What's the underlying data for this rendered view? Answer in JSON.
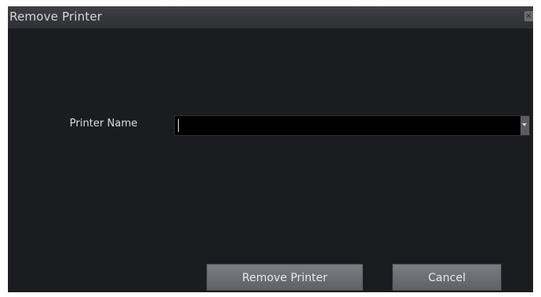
{
  "window": {
    "title": "Remove Printer",
    "close_label": "×"
  },
  "form": {
    "printer_name_label": "Printer Name",
    "printer_name_value": ""
  },
  "buttons": {
    "remove_label": "Remove Printer",
    "cancel_label": "Cancel"
  },
  "colors": {
    "dialog_background": "#1b1c1f",
    "input_background": "#000000",
    "button_background": "#6d6f74"
  }
}
